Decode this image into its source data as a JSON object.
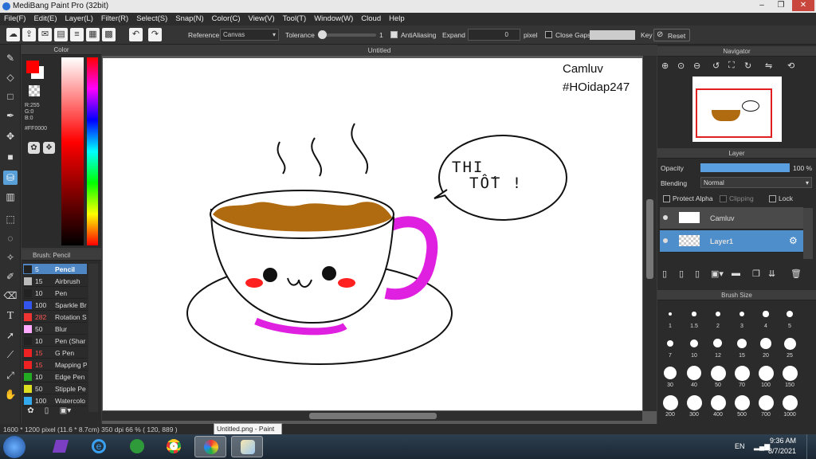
{
  "app": {
    "title": "MediBang Paint Pro (32bit)"
  },
  "menu": [
    "File(F)",
    "Edit(E)",
    "Layer(L)",
    "Filter(R)",
    "Select(S)",
    "Snap(N)",
    "Color(C)",
    "View(V)",
    "Tool(T)",
    "Window(W)",
    "Cloud",
    "Help"
  ],
  "toolbar": {
    "reference_label": "Reference",
    "reference_value": "Canvas",
    "tolerance_label": "Tolerance",
    "tolerance_value": "1",
    "antialiasing_label": "AntiAliasing",
    "expand_label": "Expand",
    "expand_value": "0",
    "expand_unit": "pixel",
    "close_gaps_label": "Close Gaps",
    "key_label": "Key",
    "reset_label": "Reset"
  },
  "color_panel": {
    "title": "Color",
    "r": "R:255",
    "g": "G:0",
    "b": "B:0",
    "hex": "#FF0000",
    "fg_color": "#ff0000"
  },
  "brush_panel": {
    "title": "Brush: Pencil",
    "items": [
      {
        "size": "5",
        "name": "Pencil",
        "color": "#222222"
      },
      {
        "size": "15",
        "name": "Airbrush",
        "color": "#bbbbbb"
      },
      {
        "size": "10",
        "name": "Pen",
        "color": "#222222"
      },
      {
        "size": "100",
        "name": "Sparkle Br",
        "color": "#3355ee"
      },
      {
        "size": "282",
        "name": "Rotation S",
        "color": "#ee3333"
      },
      {
        "size": "50",
        "name": "Blur",
        "color": "#ffaaff"
      },
      {
        "size": "10",
        "name": "Pen (Shar",
        "color": "#222222"
      },
      {
        "size": "15",
        "name": "G Pen",
        "color": "#ee2222"
      },
      {
        "size": "15",
        "name": "Mapping P",
        "color": "#ee2222"
      },
      {
        "size": "10",
        "name": "Edge Pen",
        "color": "#22aa22"
      },
      {
        "size": "50",
        "name": "Stipple Pe",
        "color": "#dddd22"
      },
      {
        "size": "100",
        "name": "Watercolo",
        "color": "#33aaee"
      }
    ]
  },
  "document": {
    "tab_title": "Untitled"
  },
  "canvas_text": {
    "watermark_1": "Camluv",
    "watermark_2": "#HOidap247",
    "bubble_1": "THI",
    "bubble_2": "TỐT !"
  },
  "navigator": {
    "title": "Navigator"
  },
  "layer_panel": {
    "title": "Layer",
    "opacity_label": "Opacity",
    "opacity_value": "100 %",
    "opacity_fraction": 1.0,
    "blending_label": "Blending",
    "blending_value": "Normal",
    "protect_alpha": "Protect Alpha",
    "clipping": "Clipping",
    "lock": "Lock",
    "layers": [
      {
        "name": "Camluv",
        "selected": false
      },
      {
        "name": "Layer1",
        "selected": true
      }
    ]
  },
  "brush_size": {
    "title": "Brush Size",
    "sizes": [
      "1",
      "1.5",
      "2",
      "3",
      "4",
      "5",
      "7",
      "10",
      "12",
      "15",
      "20",
      "25",
      "30",
      "40",
      "50",
      "70",
      "100",
      "150",
      "200",
      "300",
      "400",
      "500",
      "700",
      "1000"
    ]
  },
  "status": {
    "info": "1600 * 1200 pixel  (11.6 * 8.7cm)  350 dpi  66 %  ( 120, 889 )",
    "tooltip": "Untitled.png - Paint"
  },
  "taskbar": {
    "lang": "EN",
    "time": "9:36 AM",
    "date": "8/7/2021"
  },
  "colors": {
    "accent": "#4e8fcb",
    "coffee": "#b06a10",
    "magenta": "#e020e0",
    "blush": "#ff2020"
  }
}
